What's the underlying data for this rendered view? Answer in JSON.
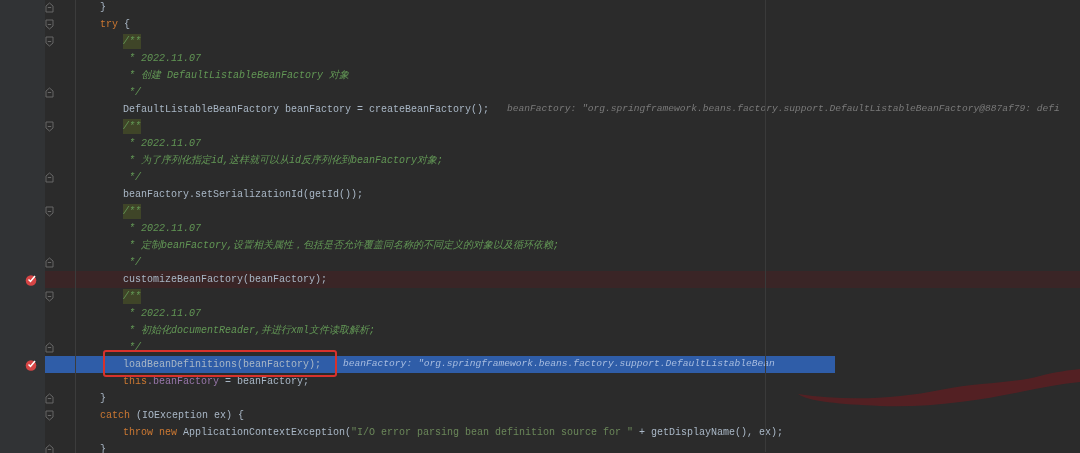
{
  "lines": [
    {
      "segments": [
        {
          "kind": "code",
          "text": "}"
        }
      ],
      "kind": "fold_end",
      "breakpoint": false,
      "current": false
    },
    {
      "segments": [
        {
          "kind": "keyword",
          "text": "try"
        },
        {
          "kind": "code",
          "text": " {"
        }
      ],
      "kind": "fold_start",
      "breakpoint": false,
      "current": false,
      "children": [
        {
          "segments": [
            {
              "kind": "doc_open",
              "text": "/**"
            }
          ],
          "kind": "fold_start",
          "breakpoint": false,
          "current": false
        },
        {
          "segments": [
            {
              "kind": "comment",
              "text": " * 2022.11.07"
            }
          ],
          "kind": "plain",
          "breakpoint": false,
          "current": false
        },
        {
          "segments": [
            {
              "kind": "comment",
              "text": " * 创建 DefaultListableBeanFactory 对象"
            }
          ],
          "kind": "plain",
          "breakpoint": false,
          "current": false
        },
        {
          "segments": [
            {
              "kind": "comment",
              "text": " */"
            }
          ],
          "kind": "fold_end",
          "breakpoint": false,
          "current": false
        },
        {
          "segments": [
            {
              "kind": "code",
              "text": "DefaultListableBeanFactory beanFactory = createBeanFactory();"
            },
            {
              "kind": "hint",
              "text": "beanFactory: \"org.springframework.beans.factory.support.DefaultListableBeanFactory@887af79: defi"
            }
          ],
          "kind": "plain",
          "breakpoint": false,
          "current": false
        },
        {
          "segments": [
            {
              "kind": "doc_open",
              "text": "/**"
            }
          ],
          "kind": "fold_start",
          "breakpoint": false,
          "current": false
        },
        {
          "segments": [
            {
              "kind": "comment",
              "text": " * 2022.11.07"
            }
          ],
          "kind": "plain",
          "breakpoint": false,
          "current": false
        },
        {
          "segments": [
            {
              "kind": "comment",
              "text": " * 为了序列化指定id,这样就可以从id反序列化到beanFactory对象;"
            }
          ],
          "kind": "plain",
          "breakpoint": false,
          "current": false
        },
        {
          "segments": [
            {
              "kind": "comment",
              "text": " */"
            }
          ],
          "kind": "fold_end",
          "breakpoint": false,
          "current": false
        },
        {
          "segments": [
            {
              "kind": "code",
              "text": "beanFactory.setSerializationId(getId());"
            }
          ],
          "kind": "plain",
          "breakpoint": false,
          "current": false
        },
        {
          "segments": [
            {
              "kind": "doc_open",
              "text": "/**"
            }
          ],
          "kind": "fold_start",
          "breakpoint": false,
          "current": false
        },
        {
          "segments": [
            {
              "kind": "comment",
              "text": " * 2022.11.07"
            }
          ],
          "kind": "plain",
          "breakpoint": false,
          "current": false
        },
        {
          "segments": [
            {
              "kind": "comment",
              "text": " * 定制beanFactory,设置相关属性，包括是否允许覆盖同名称的不同定义的对象以及循环依赖;"
            }
          ],
          "kind": "plain",
          "breakpoint": false,
          "current": false
        },
        {
          "segments": [
            {
              "kind": "comment",
              "text": " */"
            }
          ],
          "kind": "fold_end",
          "breakpoint": false,
          "current": false
        },
        {
          "segments": [
            {
              "kind": "code",
              "text": "customizeBeanFactory(beanFactory);"
            }
          ],
          "kind": "plain",
          "breakpoint": true,
          "current": false
        },
        {
          "segments": [
            {
              "kind": "doc_open",
              "text": "/**"
            }
          ],
          "kind": "fold_start",
          "breakpoint": false,
          "current": false
        },
        {
          "segments": [
            {
              "kind": "comment",
              "text": " * 2022.11.07"
            }
          ],
          "kind": "plain",
          "breakpoint": false,
          "current": false
        },
        {
          "segments": [
            {
              "kind": "comment",
              "text": " * 初始化documentReader,并进行xml文件读取解析;"
            }
          ],
          "kind": "plain",
          "breakpoint": false,
          "current": false
        },
        {
          "segments": [
            {
              "kind": "comment",
              "text": " */"
            }
          ],
          "kind": "fold_end",
          "breakpoint": false,
          "current": false
        },
        {
          "segments": [
            {
              "kind": "code",
              "text": "loadBeanDefinitions(beanFactory);"
            },
            {
              "kind": "hint",
              "text": "beanFactory: \"org.springframework.beans.factory.support.DefaultListableBean"
            }
          ],
          "kind": "plain",
          "breakpoint": true,
          "current": true
        },
        {
          "segments": [
            {
              "kind": "keyword",
              "text": "this"
            },
            {
              "kind": "field",
              "text": ".beanFactory"
            },
            {
              "kind": "code",
              "text": " = beanFactory;"
            }
          ],
          "kind": "plain",
          "breakpoint": false,
          "current": false
        }
      ]
    },
    {
      "segments": [
        {
          "kind": "code",
          "text": "}"
        }
      ],
      "kind": "fold_end",
      "breakpoint": false,
      "current": false
    },
    {
      "segments": [
        {
          "kind": "keyword",
          "text": "catch"
        },
        {
          "kind": "code",
          "text": " (IOException ex) {"
        }
      ],
      "kind": "fold_start",
      "breakpoint": false,
      "current": false,
      "children": [
        {
          "segments": [
            {
              "kind": "keyword",
              "text": "throw new "
            },
            {
              "kind": "code",
              "text": "ApplicationContextException("
            },
            {
              "kind": "string",
              "text": "\"I/O error parsing bean definition source for \""
            },
            {
              "kind": "code",
              "text": " + getDisplayName(), ex);"
            }
          ],
          "kind": "plain",
          "breakpoint": false,
          "current": false
        }
      ]
    },
    {
      "segments": [
        {
          "kind": "code",
          "text": "}"
        }
      ],
      "kind": "fold_end",
      "breakpoint": false,
      "current": false
    }
  ]
}
